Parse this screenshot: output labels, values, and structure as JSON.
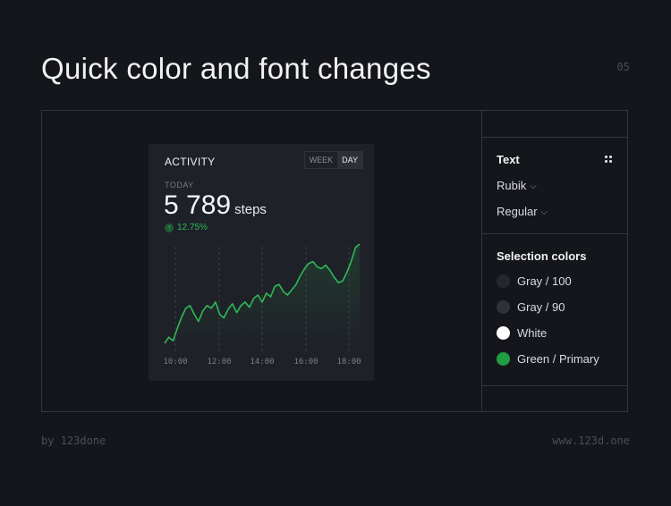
{
  "page": {
    "title": "Quick color and font changes",
    "page_number": "05",
    "footer_left": "by 123done",
    "footer_right": "www.123d.one"
  },
  "activity_card": {
    "title": "ACTIVITY",
    "toggle": [
      "WEEK",
      "DAY"
    ],
    "active_toggle": "DAY",
    "period_label": "TODAY",
    "value": "5 789",
    "unit": "steps",
    "change": "12.75%",
    "change_icon": "arrow-up-icon",
    "x_ticks": [
      "10:00",
      "12:00",
      "14:00",
      "16:00",
      "18:00"
    ]
  },
  "chart_data": {
    "type": "line",
    "title": "",
    "xlabel": "",
    "ylabel": "",
    "x_tick_labels": [
      "10:00",
      "12:00",
      "14:00",
      "16:00",
      "18:00"
    ],
    "series": [
      {
        "values": [
          5,
          12,
          8,
          22,
          35,
          45,
          48,
          38,
          30,
          42,
          48,
          45,
          52,
          38,
          34,
          44,
          50,
          40,
          48,
          52,
          46,
          56,
          60,
          52,
          62,
          58,
          70,
          72,
          64,
          60,
          66,
          72,
          82,
          90,
          96,
          98,
          92,
          90,
          94,
          88,
          80,
          74,
          76,
          86,
          98,
          114,
          118
        ],
        "color": "#2fb957"
      }
    ]
  },
  "panel": {
    "text_section": {
      "heading": "Text",
      "font_family": "Rubik",
      "font_weight": "Regular"
    },
    "colors_section": {
      "heading": "Selection colors",
      "swatches": [
        {
          "label": "Gray / 100",
          "color": "#25272f"
        },
        {
          "label": "Gray / 90",
          "color": "#30323b"
        },
        {
          "label": "White",
          "color": "#ffffff"
        },
        {
          "label": "Green / Primary",
          "color": "#1f9e45"
        }
      ]
    }
  },
  "colors": {
    "background": "#15161b",
    "card": "#1f2128",
    "accent": "#2fb957"
  }
}
